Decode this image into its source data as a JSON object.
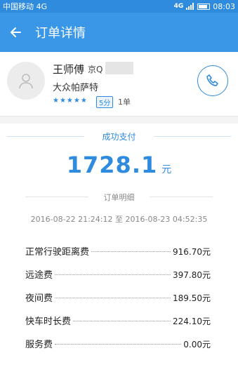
{
  "status_bar": {
    "carrier": "中国移动 4G",
    "network": "4G",
    "time": "08:03"
  },
  "app_bar": {
    "title": "订单详情"
  },
  "driver": {
    "name": "王师傅",
    "plate": "京Q",
    "car": "大众帕萨特",
    "stars": "★★★★★",
    "score": "5分",
    "orders": "1单"
  },
  "payment": {
    "status": "成功支付",
    "amount": "1728.1",
    "unit": "元"
  },
  "details": {
    "title": "订单明细",
    "time_range": "2016-08-22 21:24:12 至 2016-08-23 04:52:35",
    "fees": [
      {
        "label": "正常行驶距离费",
        "value": "916.70元"
      },
      {
        "label": "远途费",
        "value": "397.80元"
      },
      {
        "label": "夜间费",
        "value": "189.50元"
      },
      {
        "label": "快车时长费",
        "value": "224.10元"
      },
      {
        "label": "服务费",
        "value": "0.00元"
      }
    ]
  },
  "colors": {
    "primary": "#3a97e8",
    "accent": "#2f8bde"
  }
}
